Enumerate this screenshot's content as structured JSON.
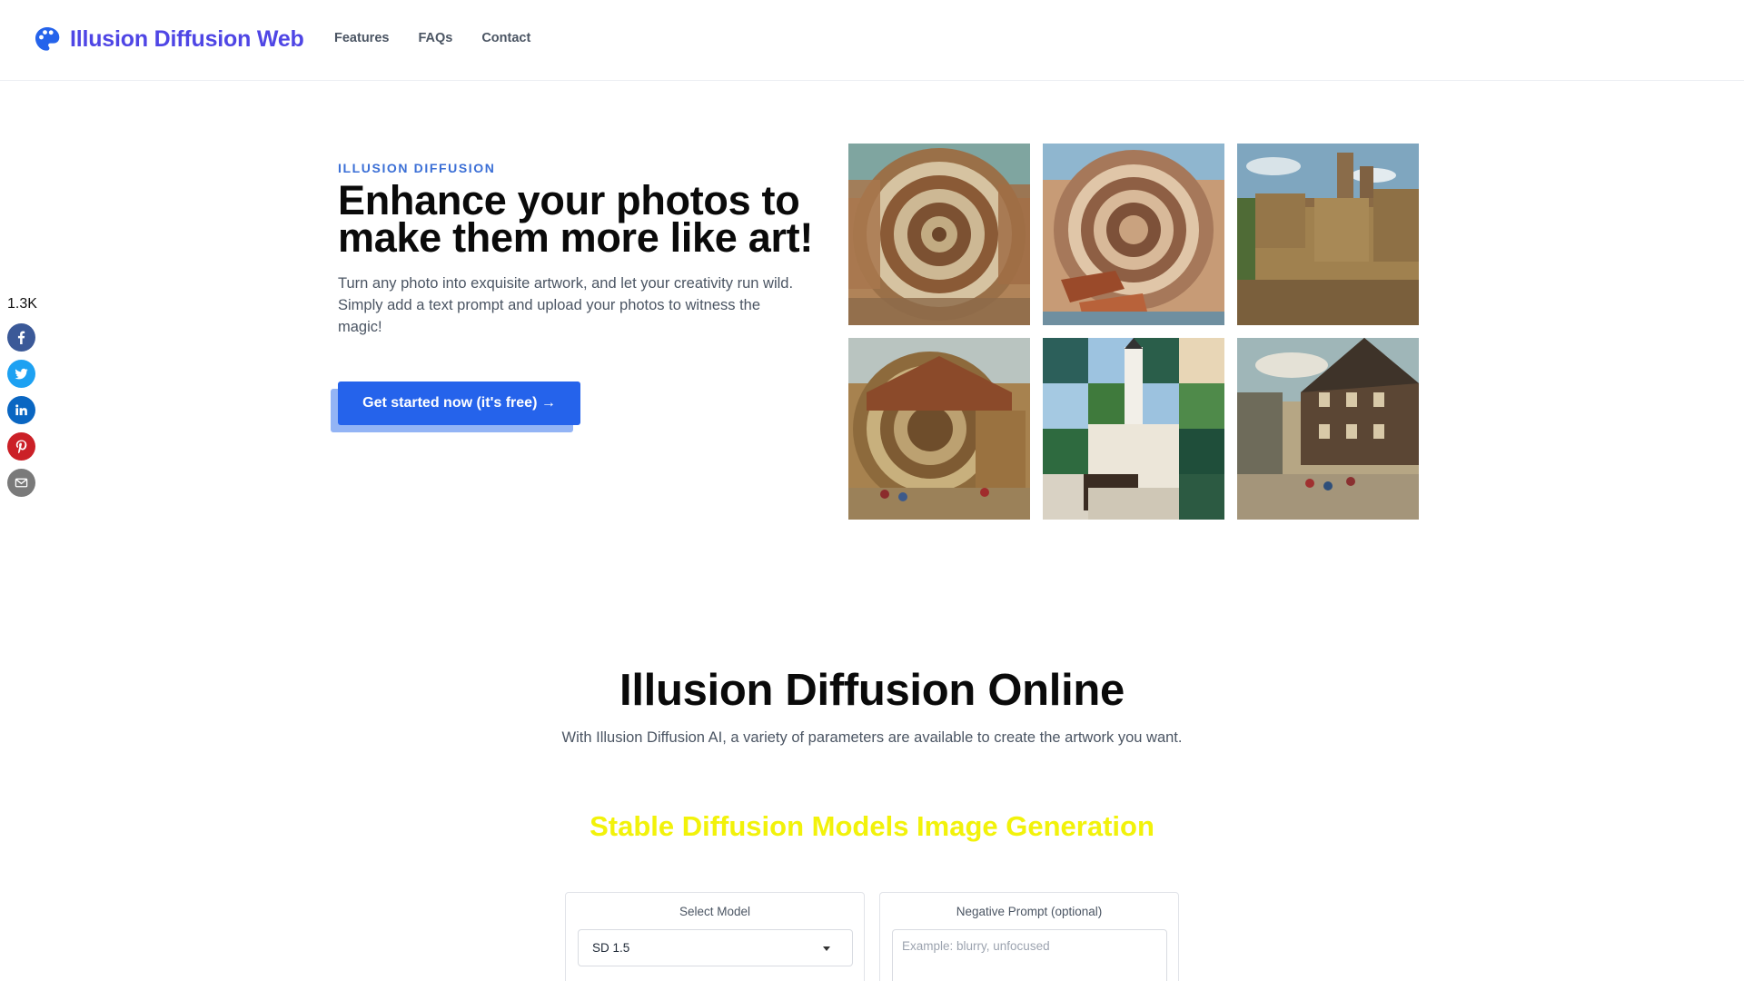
{
  "header": {
    "logo_text": "Illusion Diffusion Web",
    "logo_icon": "palette-icon",
    "brand_color": "#4f46e5",
    "nav": [
      {
        "label": "Features"
      },
      {
        "label": "FAQs"
      },
      {
        "label": "Contact"
      }
    ]
  },
  "social": {
    "share_count": "1.3K",
    "buttons": [
      {
        "icon": "facebook-icon",
        "color": "#3b5998"
      },
      {
        "icon": "twitter-icon",
        "color": "#1da1f2"
      },
      {
        "icon": "linkedin-icon",
        "color": "#0a66c2"
      },
      {
        "icon": "pinterest-icon",
        "color": "#cb2027"
      },
      {
        "icon": "email-icon",
        "color": "#7a7a7a"
      }
    ]
  },
  "hero": {
    "eyebrow": "ILLUSION DIFFUSION",
    "title": "Enhance your photos to make them more like art!",
    "subtitle": "Turn any photo into exquisite artwork, and let your creativity run wild. Simply add a text prompt and upload your photos to witness the magic!",
    "cta_label": "Get started now (it's free) →",
    "cta_color": "#2563eb"
  },
  "online_section": {
    "title": "Illusion Diffusion Online",
    "subtitle": "With Illusion Diffusion AI, a variety of parameters are available to create the artwork you want.",
    "generator_heading": "Stable Diffusion Models Image Generation",
    "generator_heading_color": "#f2f20a"
  },
  "form": {
    "model_label": "Select Model",
    "model_value": "SD 1.5",
    "negative_label": "Negative Prompt (optional)",
    "negative_placeholder": "Example: blurry, unfocused"
  }
}
